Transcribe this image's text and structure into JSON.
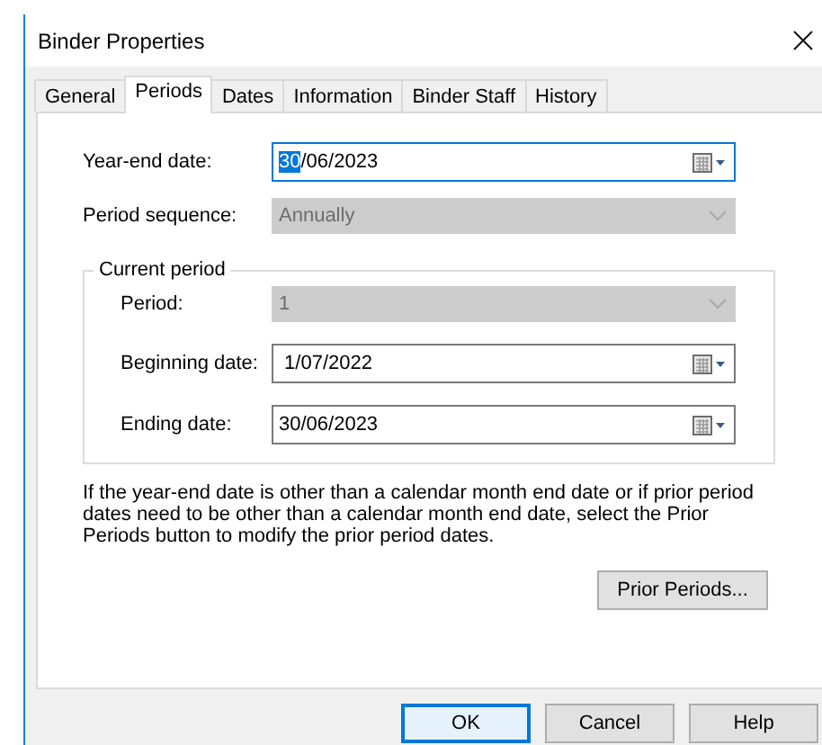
{
  "window": {
    "title": "Binder Properties"
  },
  "tabs": [
    {
      "label": "General",
      "selected": false
    },
    {
      "label": "Periods",
      "selected": true
    },
    {
      "label": "Dates",
      "selected": false
    },
    {
      "label": "Information",
      "selected": false
    },
    {
      "label": "Binder Staff",
      "selected": false
    },
    {
      "label": "History",
      "selected": false
    }
  ],
  "fields": [
    {
      "kind": "date",
      "label": "Year-end date:",
      "value_parts": [
        {
          "text": "30",
          "selected": true
        },
        {
          "text": "/06/2023",
          "selected": false
        }
      ],
      "disabled": false,
      "focused": true
    },
    {
      "kind": "combo",
      "label": "Period sequence:",
      "value": "Annually",
      "disabled": true,
      "focused": false
    }
  ],
  "current_period": {
    "legend": "Current period",
    "fields": [
      {
        "kind": "combo",
        "label": "Period:",
        "value": "1",
        "disabled": true,
        "focused": false
      },
      {
        "kind": "date",
        "label": "Beginning date:",
        "value": " 1/07/2022",
        "disabled": false,
        "focused": false
      },
      {
        "kind": "date",
        "label": "Ending date:",
        "value": "30/06/2023",
        "disabled": false,
        "focused": false
      }
    ]
  },
  "note": "If the year-end date is other than a calendar month end date or if prior period dates need to be other than a calendar month end date, select the Prior Periods button to modify the prior period dates.",
  "prior_periods_button": {
    "label": "Prior Periods..."
  },
  "buttons": [
    {
      "label": "OK",
      "default": true
    },
    {
      "label": "Cancel",
      "default": false
    },
    {
      "label": "Help",
      "default": false
    }
  ]
}
